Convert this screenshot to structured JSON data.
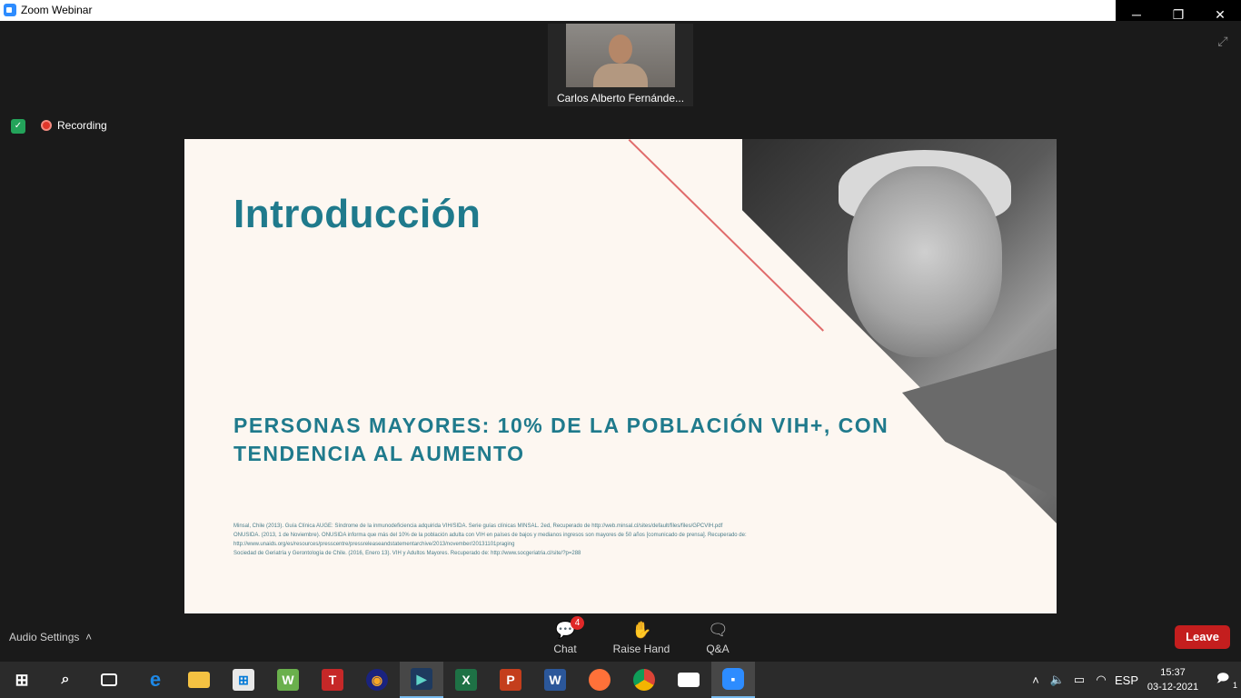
{
  "window": {
    "title": "Zoom Webinar"
  },
  "video": {
    "participant_name": "Carlos Alberto Fernánde..."
  },
  "status": {
    "recording_label": "Recording"
  },
  "slide": {
    "title": "Introducción",
    "subtitle_line1": "PERSONAS MAYORES: 10% DE LA POBLACIÓN VIH+, CON",
    "subtitle_line2": "TENDENCIA AL AUMENTO",
    "refs": [
      "Minsal, Chile (2013). Guía Clínica AUGE: Síndrome de la inmunodeficiencia adquirida VIH/SIDA. Serie guías clínicas MINSAL. 2ed, Recuperado de http://web.minsal.cl/sites/default/files/files/GPCVIH.pdf",
      "ONUSIDA. (2013, 1 de Noviembre). ONUSIDA informa que más del 10% de la población adulta con VIH en países de bajos y medianos ingresos son mayores de 50 años [comunicado de prensa]. Recuperado de:",
      "http://www.unaids.org/es/resources/presscentre/pressreleaseandstatementarchive/2013/november/20131101praging",
      "Sociedad de Geriatría y Gerontología de Chile. (2016, Enero 13). VIH y Adultos Mayores. Recuperado de: http://www.socgeriatria.cl/site/?p=288"
    ]
  },
  "controls": {
    "audio_settings": "Audio Settings",
    "chat_label": "Chat",
    "chat_badge": "4",
    "raise_hand_label": "Raise Hand",
    "qa_label": "Q&A",
    "leave_label": "Leave"
  },
  "taskbar": {
    "language": "ESP",
    "time": "15:37",
    "date": "03-12-2021",
    "notifications": "1"
  }
}
